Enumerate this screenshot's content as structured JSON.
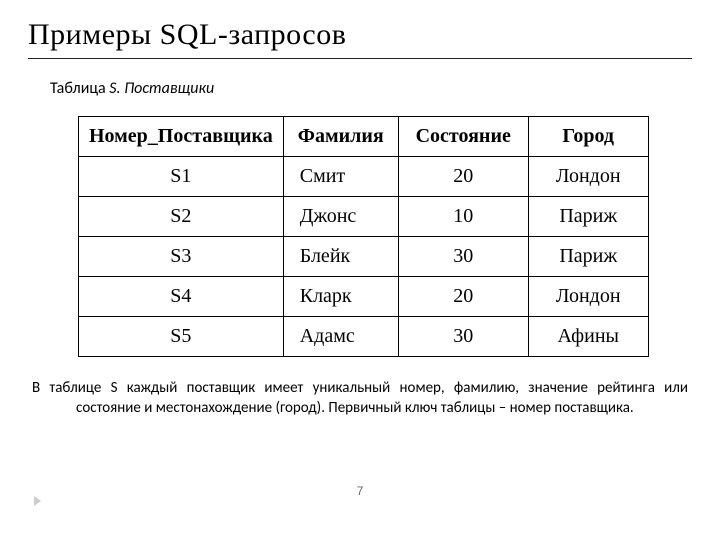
{
  "title": "Примеры SQL-запросов",
  "caption_prefix": "Таблица ",
  "caption_code": "S",
  "caption_suffix": ". Поставщики",
  "table": {
    "headers": [
      "Номер_Поставщика",
      "Фамилия",
      "Состояние",
      "Город"
    ],
    "rows": [
      {
        "id": "S1",
        "fam": "Смит",
        "state": "20",
        "city": "Лондон"
      },
      {
        "id": "S2",
        "fam": "Джонс",
        "state": "10",
        "city": "Париж"
      },
      {
        "id": "S3",
        "fam": "Блейк",
        "state": "30",
        "city": "Париж"
      },
      {
        "id": "S4",
        "fam": "Кларк",
        "state": "20",
        "city": "Лондон"
      },
      {
        "id": "S5",
        "fam": "Адамс",
        "state": "30",
        "city": "Афины"
      }
    ]
  },
  "footer": "В таблице S каждый поставщик имеет уникальный номер, фамилию, значение рейтинга или состояние и местонахождение (город). Первичный ключ таблицы – номер поставщика.",
  "page_number": "7",
  "chart_data": {
    "type": "table",
    "title": "Таблица S. Поставщики",
    "columns": [
      "Номер_Поставщика",
      "Фамилия",
      "Состояние",
      "Город"
    ],
    "rows": [
      [
        "S1",
        "Смит",
        20,
        "Лондон"
      ],
      [
        "S2",
        "Джонс",
        10,
        "Париж"
      ],
      [
        "S3",
        "Блейк",
        30,
        "Париж"
      ],
      [
        "S4",
        "Кларк",
        20,
        "Лондон"
      ],
      [
        "S5",
        "Адамс",
        30,
        "Афины"
      ]
    ]
  }
}
